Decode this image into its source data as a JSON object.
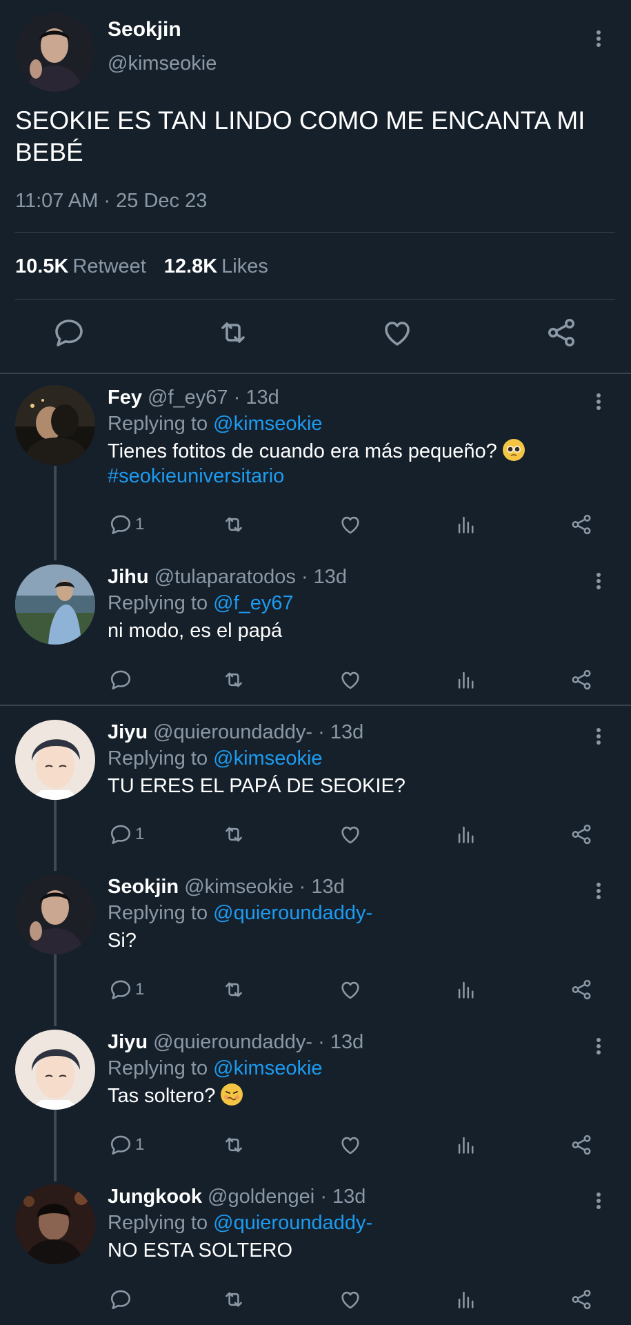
{
  "main": {
    "name": "Seokjin",
    "handle": "@kimseokie",
    "text": "SEOKIE ES TAN LINDO COMO ME ENCANTA MI BEBÉ",
    "time": "11:07 AM · 25 Dec 23",
    "retweets_count": "10.5K",
    "retweets_label": "Retweet",
    "likes_count": "12.8K",
    "likes_label": "Likes"
  },
  "replies": [
    {
      "name": "Fey",
      "handle": "@f_ey67",
      "age": "· 13d",
      "replying_label": "Replying to",
      "replying_to": "@kimseokie",
      "text": "Tienes fotitos de cuando era más pequeño?",
      "emoji": "pleading-face",
      "hashtag": "#seokieuniversitario",
      "reply_count": "1"
    },
    {
      "name": "Jihu",
      "handle": "@tulaparatodos",
      "age": "· 13d",
      "replying_label": "Replying to",
      "replying_to": "@f_ey67",
      "text": "ni modo, es el papá",
      "reply_count": ""
    },
    {
      "name": "Jiyu",
      "handle": "@quieroundaddy-",
      "age": "· 13d",
      "replying_label": "Replying to",
      "replying_to": "@kimseokie",
      "text": "TU ERES EL PAPÁ DE SEOKIE?",
      "reply_count": "1"
    },
    {
      "name": "Seokjin",
      "handle": "@kimseokie",
      "age": "· 13d",
      "replying_label": "Replying to",
      "replying_to": "@quieroundaddy-",
      "text": "Si?",
      "reply_count": "1"
    },
    {
      "name": "Jiyu",
      "handle": "@quieroundaddy-",
      "age": "· 13d",
      "replying_label": "Replying to",
      "replying_to": "@kimseokie",
      "text": "Tas soltero?",
      "emoji": "woozy-face",
      "reply_count": "1"
    },
    {
      "name": "Jungkook",
      "handle": "@goldengei",
      "age": "· 13d",
      "replying_label": "Replying to",
      "replying_to": "@quieroundaddy-",
      "text": "NO ESTA SOLTERO",
      "reply_count": ""
    }
  ],
  "colors": {
    "background": "#15202b",
    "accent": "#1d9bf0",
    "muted": "#8b98a5",
    "divider": "#38444d"
  },
  "icons": [
    "reply-icon",
    "retweet-icon",
    "like-icon",
    "share-icon",
    "views-icon",
    "more-icon"
  ]
}
